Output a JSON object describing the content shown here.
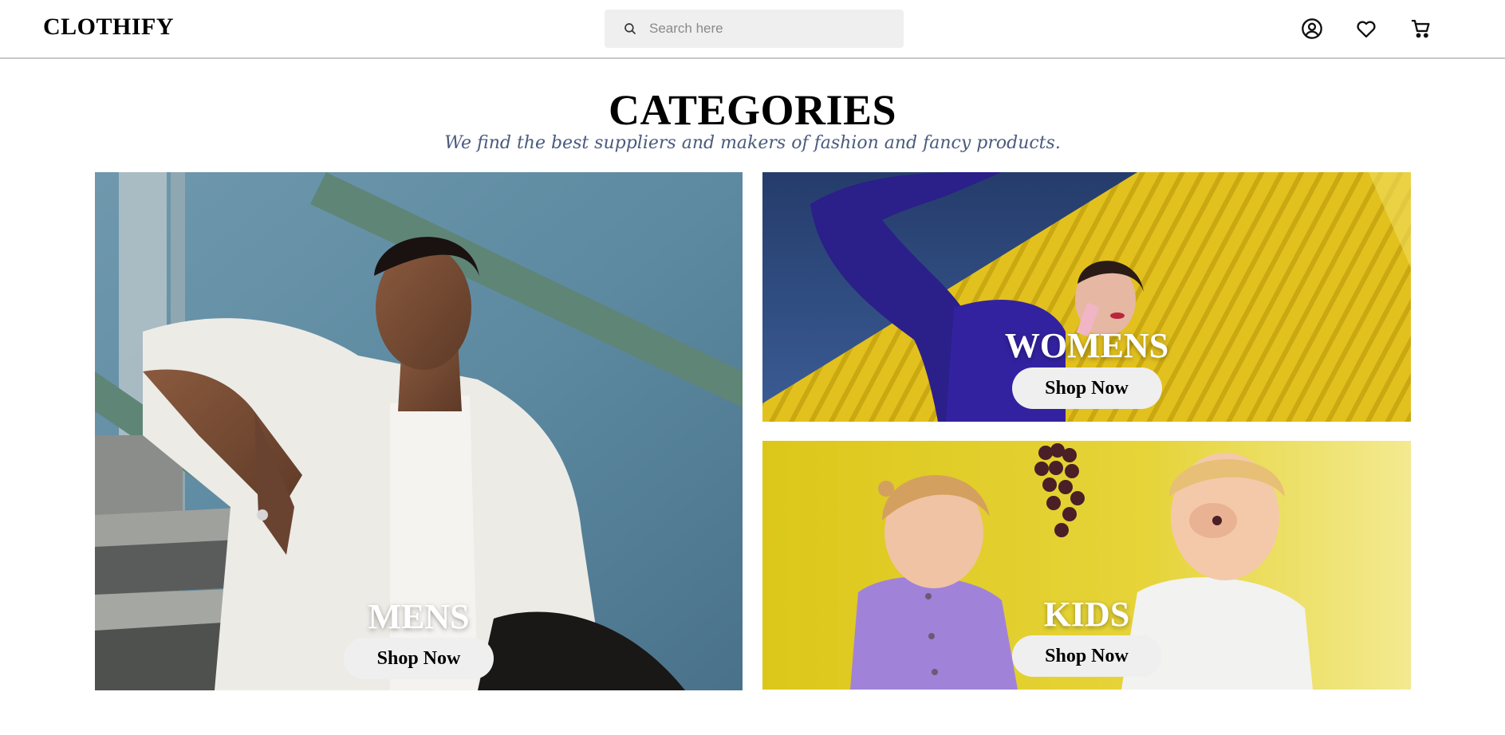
{
  "header": {
    "logo": "CLOTHIFY",
    "search_placeholder": "Search here",
    "icons": [
      "user-icon",
      "heart-icon",
      "cart-icon"
    ]
  },
  "page": {
    "title": "CATEGORIES",
    "subtitle": "We find the best suppliers and makers of fashion and fancy products."
  },
  "categories": [
    {
      "label": "MENS",
      "button": "Shop Now"
    },
    {
      "label": "WOMENS",
      "button": "Shop Now"
    },
    {
      "label": "KIDS",
      "button": "Shop Now"
    }
  ],
  "colors": {
    "subtitle": "#4b5a7e",
    "button_bg": "#efefef",
    "search_bg": "#efefef",
    "header_border": "#c9c9c9"
  }
}
